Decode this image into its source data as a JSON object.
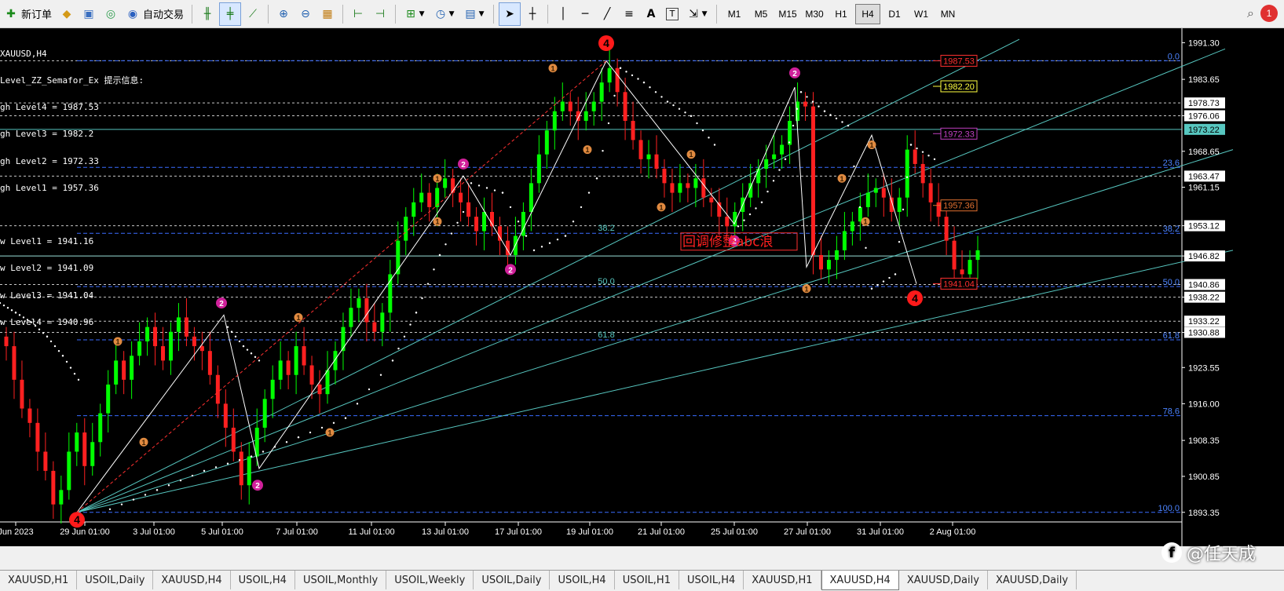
{
  "toolbar": {
    "new_order": "新订单",
    "auto_trading": "自动交易",
    "timeframes": [
      "M1",
      "M5",
      "M15",
      "M30",
      "H1",
      "H4",
      "D1",
      "W1",
      "MN"
    ],
    "active_timeframe": "H4",
    "notification_count": "1"
  },
  "chart": {
    "symbol_label": "XAUUSD,H4",
    "indicator_lines": [
      "Level_ZZ_Semafor_Ex 提示信息:",
      "gh Level4 = 1987.53",
      "gh Level3 = 1982.2",
      "gh Level2 = 1972.33",
      "gh Level1 = 1957.36",
      "",
      "w Level1 = 1941.16",
      "w Level2 = 1941.09",
      "w Level3 = 1941.04",
      "w Level4 = 1940.96"
    ],
    "annotation_text": "回调修整abc浪",
    "price_axis_labels": [
      "1991.30",
      "1983.65",
      "1976.06",
      "1968.65",
      "1961.15",
      "1953.12",
      "1946.82",
      "1938.22",
      "1930.88",
      "1923.55",
      "1916.00",
      "1908.35",
      "1900.85",
      "1893.35"
    ],
    "price_boxes": [
      {
        "value": "1978.73",
        "bg": "#ffffff",
        "fg": "#000000"
      },
      {
        "value": "1976.06",
        "bg": "#ffffff",
        "fg": "#000000"
      },
      {
        "value": "1973.22",
        "bg": "#57c7c0",
        "fg": "#000000"
      },
      {
        "value": "1963.47",
        "bg": "#ffffff",
        "fg": "#000000"
      },
      {
        "value": "1953.12",
        "bg": "#ffffff",
        "fg": "#000000"
      },
      {
        "value": "1946.82",
        "bg": "#ffffff",
        "fg": "#000000"
      },
      {
        "value": "1940.86",
        "bg": "#ffffff",
        "fg": "#000000"
      },
      {
        "value": "1938.22",
        "bg": "#ffffff",
        "fg": "#000000"
      },
      {
        "value": "1933.22",
        "bg": "#ffffff",
        "fg": "#000000"
      },
      {
        "value": "1930.88",
        "bg": "#ffffff",
        "fg": "#000000"
      }
    ],
    "level_tags": [
      {
        "value": "1987.53",
        "color": "#ff3030"
      },
      {
        "value": "1982.20",
        "color": "#ffff40"
      },
      {
        "value": "1972.33",
        "color": "#c040c0"
      },
      {
        "value": "1957.36",
        "color": "#e07030"
      },
      {
        "value": "1941.04",
        "color": "#ff3030"
      }
    ],
    "fib_right_labels": [
      "0.0",
      "23.6",
      "38.2",
      "50.0",
      "61.8",
      "78.6",
      "100.0"
    ],
    "fib_mid_labels": [
      "38.2",
      "50.0",
      "61.8"
    ],
    "time_labels": [
      "Jun 2023",
      "29 Jun 01:00",
      "3 Jul 01:00",
      "5 Jul 01:00",
      "7 Jul 01:00",
      "11 Jul 01:00",
      "13 Jul 01:00",
      "17 Jul 01:00",
      "19 Jul 01:00",
      "21 Jul 01:00",
      "25 Jul 01:00",
      "27 Jul 01:00",
      "31 Jul 01:00",
      "2 Aug 01:00"
    ],
    "wave_labels": [
      "4",
      "4"
    ],
    "semafor_labels": [
      "1",
      "2"
    ]
  },
  "chart_data": {
    "type": "candlestick",
    "symbol": "XAUUSD",
    "timeframe": "H4",
    "ylim": [
      1892.0,
      1993.0
    ],
    "up_color": "#00ff00",
    "down_color": "#ff2020",
    "closes": [
      1928,
      1921,
      1915,
      1912,
      1906,
      1902,
      1895,
      1898,
      1906,
      1910,
      1903,
      1908,
      1914,
      1920,
      1925,
      1921,
      1926,
      1929,
      1932,
      1928,
      1925,
      1931,
      1934,
      1930,
      1928,
      1927,
      1922,
      1916,
      1911,
      1906,
      1899,
      1905,
      1911,
      1917,
      1921,
      1925,
      1922,
      1928,
      1924,
      1920,
      1918,
      1923,
      1927,
      1932,
      1936,
      1938,
      1933,
      1931,
      1935,
      1943,
      1950,
      1955,
      1958,
      1960,
      1957,
      1961,
      1963,
      1960,
      1958,
      1955,
      1952,
      1956,
      1953,
      1950,
      1947,
      1951,
      1956,
      1962,
      1968,
      1973,
      1977,
      1979,
      1977,
      1975,
      1977,
      1979,
      1983,
      1986,
      1981,
      1975,
      1971,
      1967,
      1968,
      1965,
      1962,
      1960,
      1962,
      1961,
      1963,
      1959,
      1958,
      1955,
      1953,
      1956,
      1959,
      1962,
      1965,
      1967,
      1968,
      1970,
      1975,
      1979,
      1978,
      1947,
      1944,
      1946,
      1948,
      1952,
      1954,
      1957,
      1960,
      1961,
      1959,
      1956,
      1959,
      1969,
      1966,
      1962,
      1958,
      1955,
      1950,
      1944,
      1943,
      1946,
      1948
    ]
  }
}
